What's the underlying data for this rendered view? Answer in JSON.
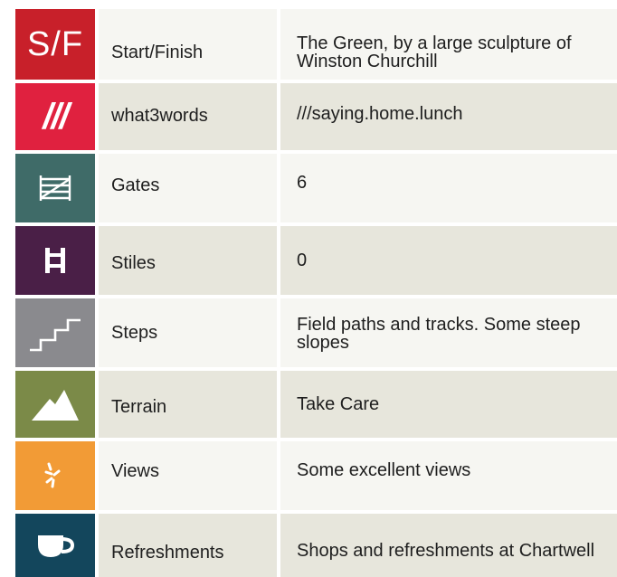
{
  "rows": [
    {
      "icon_name": "start-finish-icon",
      "icon_text": "S/F",
      "icon_color": "#c8202a",
      "label": "Start/Finish",
      "value": "The Green, by a large sculpture of Winston Churchill"
    },
    {
      "icon_name": "what3words-icon",
      "icon_text": "///",
      "icon_color": "#e0213f",
      "label": "what3words",
      "value": "///saying.home.lunch"
    },
    {
      "icon_name": "gate-icon",
      "icon_color": "#3f6b68",
      "label": "Gates",
      "value": "6"
    },
    {
      "icon_name": "stile-icon",
      "icon_color": "#4a1f47",
      "label": "Stiles",
      "value": "0"
    },
    {
      "icon_name": "steps-icon",
      "icon_color": "#8a8a8e",
      "label": "Steps",
      "value": "Field paths and tracks. Some steep slopes"
    },
    {
      "icon_name": "terrain-icon",
      "icon_color": "#7b8a48",
      "label": "Terrain",
      "value": "Take Care"
    },
    {
      "icon_name": "views-icon",
      "icon_color": "#f29b36",
      "label": "Views",
      "value": "Some excellent views"
    },
    {
      "icon_name": "refreshments-icon",
      "icon_color": "#13465c",
      "label": "Refreshments",
      "value": "Shops and refreshments at Chartwell"
    }
  ]
}
